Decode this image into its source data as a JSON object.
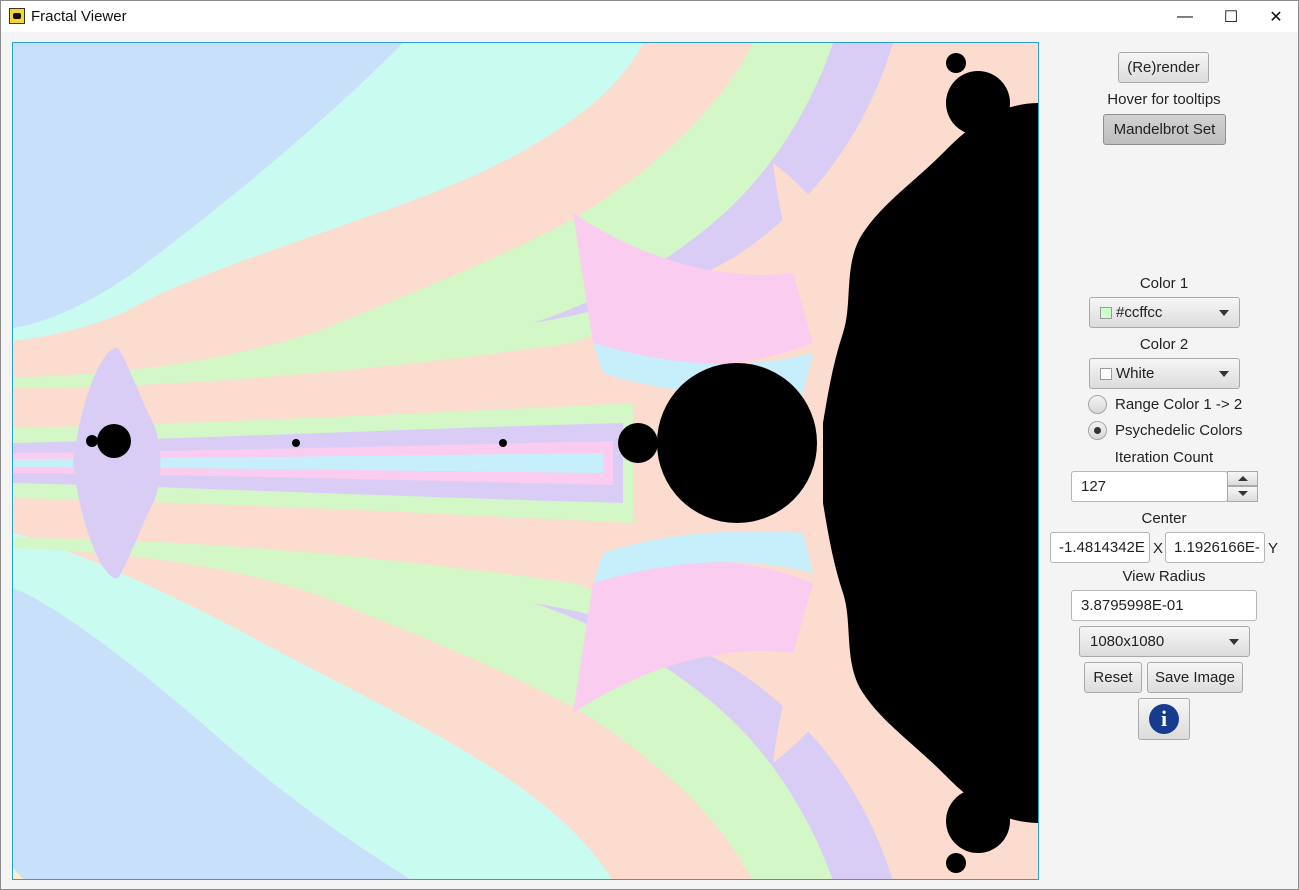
{
  "window": {
    "title": "Fractal Viewer",
    "minimize_glyph": "—",
    "maximize_glyph": "☐",
    "close_glyph": "✕"
  },
  "controls": {
    "render_label": "(Re)render",
    "hover_hint": "Hover for tooltips",
    "fractal_type_label": "Mandelbrot Set",
    "color1_label": "Color 1",
    "color1_value": "#ccffcc",
    "color2_label": "Color 2",
    "color2_value": "White",
    "range_radio_label": "Range Color 1 -> 2",
    "psychedelic_radio_label": "Psychedelic Colors",
    "iteration_label": "Iteration Count",
    "iteration_value": "127",
    "center_label": "Center",
    "center_x_value": "-1.4814342E",
    "x_axis_label": "X",
    "center_y_value": "1.1926166E-",
    "y_axis_label": "Y",
    "view_radius_label": "View Radius",
    "view_radius_value": "3.8795998E-01",
    "resolution_value": "1080x1080",
    "reset_label": "Reset",
    "save_label": "Save Image",
    "info_glyph": "i"
  },
  "colors": {
    "accent_border": "#28a0e0",
    "palette": [
      "#c9e0fb",
      "#c9fbf0",
      "#fcdcce",
      "#d4f7c8",
      "#d9cdf6",
      "#f9ccf0",
      "#c7eefb",
      "#000000"
    ]
  },
  "icons": [
    "app-icon",
    "minimize-icon",
    "maximize-icon",
    "close-icon",
    "dropdown-caret-icon",
    "spin-up-icon",
    "spin-down-icon",
    "info-icon"
  ]
}
